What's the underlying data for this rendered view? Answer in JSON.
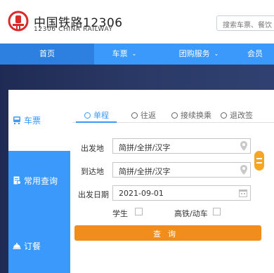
{
  "header": {
    "brand_cn": "中国铁路12306",
    "brand_en": "12306 CHINA RAILWAY",
    "search_placeholder": "搜索车票、餐饮"
  },
  "nav": {
    "items": [
      {
        "label": "首页",
        "active": true
      },
      {
        "label": "车票",
        "dropdown": true
      },
      {
        "label": "团购服务",
        "dropdown": true
      },
      {
        "label": "会员"
      }
    ]
  },
  "sidebar": {
    "items": [
      {
        "label": "车票",
        "icon": "train-icon",
        "active": true
      },
      {
        "label": "常用查询",
        "icon": "document-icon"
      },
      {
        "label": "订餐",
        "icon": "dining-icon"
      }
    ]
  },
  "tabs": [
    {
      "label": "单程",
      "active": true
    },
    {
      "label": "往返"
    },
    {
      "label": "接续换乘"
    },
    {
      "label": "退改签"
    }
  ],
  "form": {
    "from_label": "出发地",
    "from_value": "简拼/全拼/汉字",
    "to_label": "到达地",
    "to_value": "简拼/全拼/汉字",
    "date_label": "出发日期",
    "date_value": "2021-09-01",
    "student_label": "学生",
    "highspeed_label": "高铁/动车",
    "search_label": "查询"
  },
  "colors": {
    "primary": "#3b99fc",
    "accent": "#f08d1c",
    "brand_red": "#d92b2b",
    "hero": "#24335a"
  }
}
